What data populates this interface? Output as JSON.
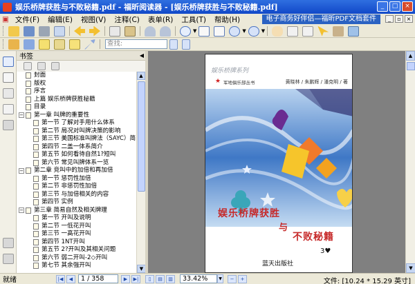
{
  "window": {
    "title": "娱乐桥牌获胜与不败秘籍.pdf - 福昕阅读器 - [娱乐桥牌获胜与不败秘籍.pdf]",
    "minimize": "_",
    "maximize": "□",
    "close": "×"
  },
  "menu": {
    "items": [
      "文件(F)",
      "编辑(E)",
      "视图(V)",
      "注释(C)",
      "表单(R)",
      "工具(T)",
      "帮助(H)"
    ],
    "ad": "电子商务好伴侣—福昕PDF文档套件"
  },
  "toolbar": {
    "find_placeholder": "查找:"
  },
  "bookmarks": {
    "header": "书签",
    "items": [
      {
        "label": "封面",
        "level": 0,
        "expander": ""
      },
      {
        "label": "版权",
        "level": 0,
        "expander": ""
      },
      {
        "label": "序言",
        "level": 0,
        "expander": ""
      },
      {
        "label": "上篇 娱乐桥牌获胜秘籍",
        "level": 0,
        "expander": ""
      },
      {
        "label": "目录",
        "level": 0,
        "expander": ""
      },
      {
        "label": "第一章 叫牌的重要性",
        "level": 0,
        "expander": "−"
      },
      {
        "label": "第一节 了解对手用什么体系",
        "level": 1,
        "expander": ""
      },
      {
        "label": "第二节 局况对叫牌决策的影响",
        "level": 1,
        "expander": ""
      },
      {
        "label": "第三节 美国标准叫牌法（SAYC）简介",
        "level": 1,
        "expander": ""
      },
      {
        "label": "第四节 二盖一体系简介",
        "level": 1,
        "expander": ""
      },
      {
        "label": "第五节 如何看待自然1?短叫",
        "level": 1,
        "expander": ""
      },
      {
        "label": "第六节 常见叫牌体系一览",
        "level": 1,
        "expander": ""
      },
      {
        "label": "第二章 竞叫中的加倍和再加倍",
        "level": 0,
        "expander": "−"
      },
      {
        "label": "第一节 惩罚性加倍",
        "level": 1,
        "expander": ""
      },
      {
        "label": "第二节 非惩罚性加倍",
        "level": 1,
        "expander": ""
      },
      {
        "label": "第三节 与加倍相关的内容",
        "level": 1,
        "expander": ""
      },
      {
        "label": "第四节 实例",
        "level": 1,
        "expander": ""
      },
      {
        "label": "第三章 简易自然及相关牌理",
        "level": 0,
        "expander": "−"
      },
      {
        "label": "第一节 开叫及说明",
        "level": 1,
        "expander": ""
      },
      {
        "label": "第二节 一低花开叫",
        "level": 1,
        "expander": ""
      },
      {
        "label": "第三节 一高花开叫",
        "level": 1,
        "expander": ""
      },
      {
        "label": "第四节 1NT开叫",
        "level": 1,
        "expander": ""
      },
      {
        "label": "第五节 2?开叫及其相关问题",
        "level": 1,
        "expander": ""
      },
      {
        "label": "第六节 弱二开叫-2◇开叫",
        "level": 1,
        "expander": ""
      },
      {
        "label": "第七节 其余强开叫",
        "level": 1,
        "expander": ""
      }
    ]
  },
  "page": {
    "series": "娱乐桥牌系列",
    "club": "军地俱乐部丛书",
    "authors": "黄晓林 / 朱鹏辉 / 潘克明 / 著",
    "title_line1": "娱乐桥牌获胜",
    "title_yu": "与",
    "title_line2": "不败秘籍",
    "mark": "3♥",
    "publisher": "蓝天出版社"
  },
  "status": {
    "ready": "就绪",
    "page_value": "1 / 358",
    "zoom_value": "33.42%",
    "doc_size": "文件: [10.24 * 15.29 英寸]"
  },
  "colors": {
    "title_gradient_top": "#2f6fe0",
    "ui_face": "#ece9d8",
    "cover_title": "#c62a2a",
    "cover_art_blue": "#3f78c6"
  }
}
